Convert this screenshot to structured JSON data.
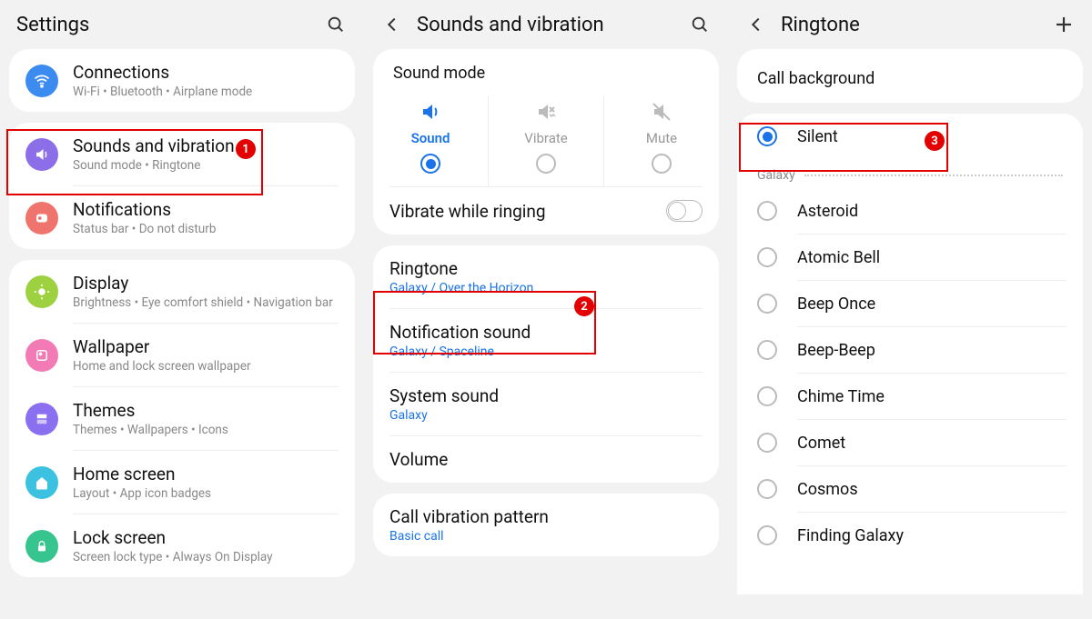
{
  "panes": {
    "settings": {
      "title": "Settings",
      "items": [
        {
          "title": "Connections",
          "sub": "Wi-Fi  •  Bluetooth  •  Airplane mode",
          "color": "#3b8bf0",
          "icon": "wifi"
        },
        {
          "title": "Sounds and vibration",
          "sub": "Sound mode  •  Ringtone",
          "color": "#8b6ee8",
          "icon": "sound"
        },
        {
          "title": "Notifications",
          "sub": "Status bar  •  Do not disturb",
          "color": "#f0746e",
          "icon": "notif"
        },
        {
          "title": "Display",
          "sub": "Brightness  •  Eye comfort shield  •  Navigation bar",
          "color": "#9ed13f",
          "icon": "disp"
        },
        {
          "title": "Wallpaper",
          "sub": "Home and lock screen wallpaper",
          "color": "#f27bb5",
          "icon": "wall"
        },
        {
          "title": "Themes",
          "sub": "Themes  •  Wallpapers  •  Icons",
          "color": "#8a6ff0",
          "icon": "theme"
        },
        {
          "title": "Home screen",
          "sub": "Layout  •  App icon badges",
          "color": "#3cc2e0",
          "icon": "home"
        },
        {
          "title": "Lock screen",
          "sub": "Screen lock type  •  Always On Display",
          "color": "#36c48f",
          "icon": "lock"
        }
      ]
    },
    "sounds": {
      "title": "Sounds and vibration",
      "sound_mode_label": "Sound mode",
      "modes": {
        "sound": "Sound",
        "vibrate": "Vibrate",
        "mute": "Mute"
      },
      "vibrate_ringing": "Vibrate while ringing",
      "items": [
        {
          "title": "Ringtone",
          "sub": "Galaxy / Over the Horizon"
        },
        {
          "title": "Notification sound",
          "sub": "Galaxy / Spaceline"
        },
        {
          "title": "System sound",
          "sub": "Galaxy"
        },
        {
          "title": "Volume",
          "sub": ""
        }
      ],
      "call_vib": {
        "title": "Call vibration pattern",
        "sub": "Basic call"
      }
    },
    "ringtone": {
      "title": "Ringtone",
      "call_bg": "Call background",
      "selected": "Silent",
      "group": "Galaxy",
      "items": [
        "Asteroid",
        "Atomic Bell",
        "Beep Once",
        "Beep-Beep",
        "Chime Time",
        "Comet",
        "Cosmos",
        "Finding Galaxy"
      ]
    }
  },
  "annotations": {
    "1": "1",
    "2": "2",
    "3": "3"
  }
}
